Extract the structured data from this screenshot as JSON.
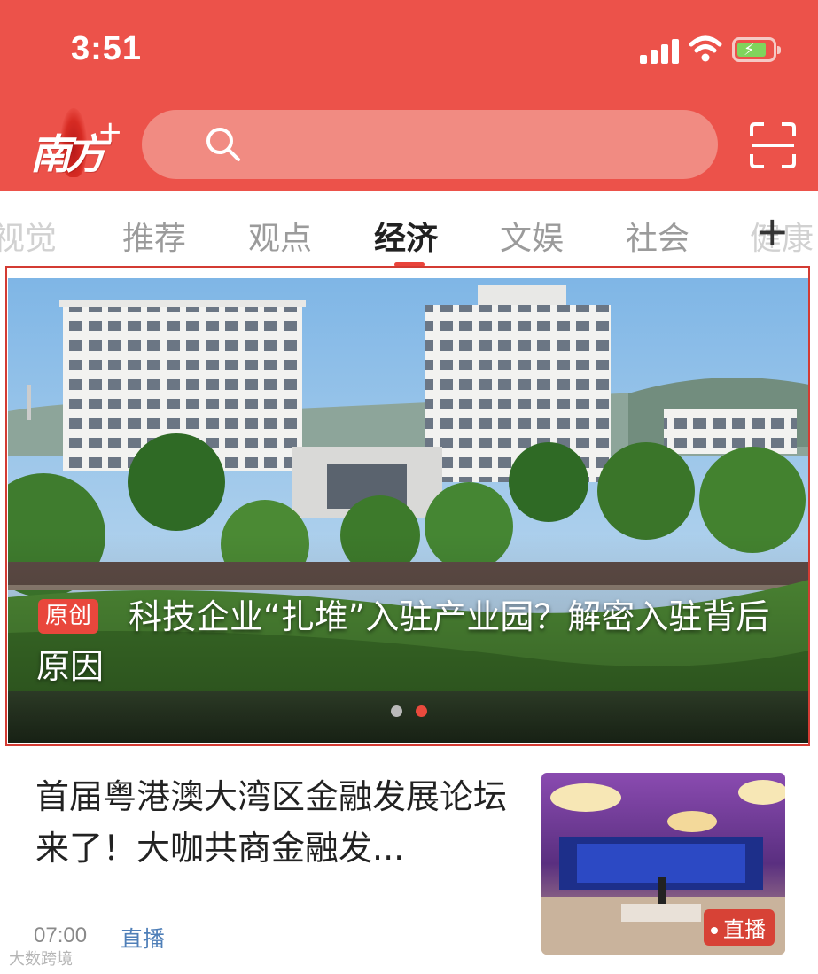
{
  "status_bar": {
    "time": "3:51",
    "icons": [
      "signal-icon",
      "wifi-icon",
      "battery-charging-icon"
    ]
  },
  "header": {
    "logo_text": "南方",
    "logo_plus": "+",
    "search_placeholder": "",
    "scan_icon": "scan-icon",
    "search_icon": "search-icon",
    "brand_color": "#ec524a"
  },
  "tabs": [
    {
      "label": "视觉",
      "active": false
    },
    {
      "label": "推荐",
      "active": false
    },
    {
      "label": "观点",
      "active": false
    },
    {
      "label": "经济",
      "active": true
    },
    {
      "label": "文娱",
      "active": false
    },
    {
      "label": "社会",
      "active": false
    },
    {
      "label": "健康",
      "active": false
    }
  ],
  "tab_add_label": "+",
  "banner": {
    "badge": "原创",
    "title": "科技企业“扎堆”入驻产业园？解密入驻背后原因",
    "carousel_total": 2,
    "carousel_active": 2
  },
  "news": [
    {
      "title": "首届粤港澳大湾区金融发展论坛来了！大咖共商金融发...",
      "time": "07:00",
      "tag": "直播",
      "thumb_badge": "直播"
    }
  ],
  "watermark": "大数跨境"
}
